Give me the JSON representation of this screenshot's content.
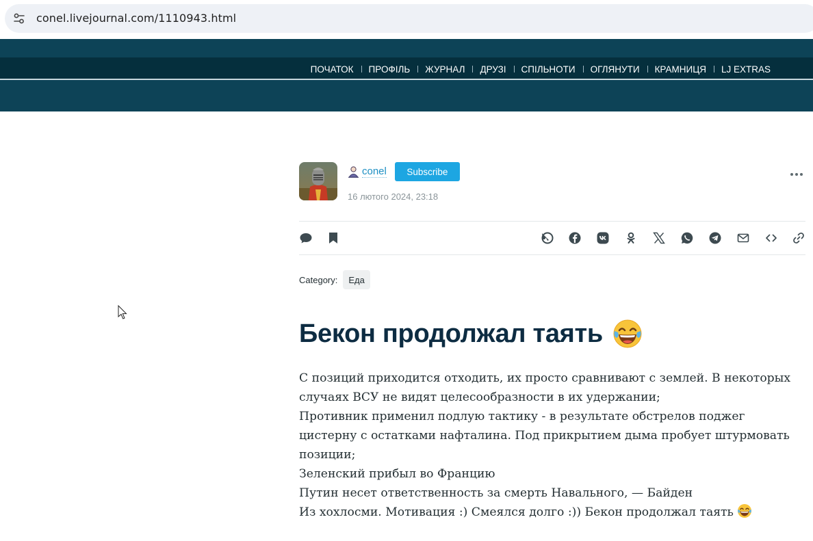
{
  "browser": {
    "url": "conel.livejournal.com/1110943.html",
    "site_info_icon": "tune-icon"
  },
  "lj_nav": {
    "items": [
      "ПОЧАТОК",
      "ПРОФІЛЬ",
      "ЖУРНАЛ",
      "ДРУЗІ",
      "СПІЛЬНОТИ",
      "ОГЛЯНУТИ",
      "КРАМНИЦЯ",
      "LJ EXTRAS"
    ]
  },
  "post": {
    "author": "conel",
    "subscribe_label": "Subscribe",
    "date": "16 лютого 2024, 23:18",
    "category_label": "Category:",
    "category_tag": "Еда",
    "title": "Бекон продолжал таять",
    "body_lines": [
      "С позиций приходится отходить, их просто сравнивают с землей. В некоторых",
      "случаях ВСУ не видят целесообразности в их удержании;",
      "Противник применил подлую тактику - в результате обстрелов поджег",
      "цистерну с остатками нафталина. Под прикрытием дыма пробует штурмовать",
      "позиции;",
      "Зеленский прибыл во Францию",
      "Путин несет ответственность за смерть Навального, — Байден",
      "Из хохлосми. Мотивация :) Смеялся долго :)) Бекон продолжал таять"
    ]
  },
  "toolbar": {
    "left_icons": [
      "comment-icon",
      "bookmark-icon"
    ],
    "share_icons": [
      "livejournal-icon",
      "facebook-icon",
      "vk-icon",
      "odnoklassniki-icon",
      "x-icon",
      "whatsapp-icon",
      "telegram-icon",
      "email-icon",
      "embed-icon",
      "link-icon"
    ]
  },
  "colors": {
    "header_bg": "#0d4357",
    "header_band": "#052f3d",
    "accent": "#1da6e2",
    "title": "#0d2c42",
    "link": "#1c8fc3"
  }
}
